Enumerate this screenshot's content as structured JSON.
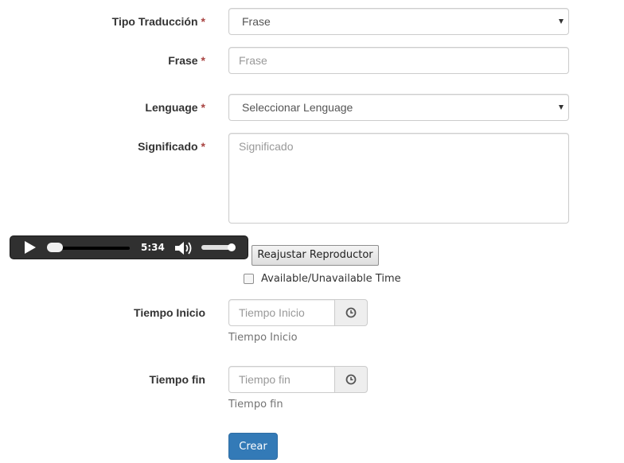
{
  "form": {
    "tipo_traduccion": {
      "label": "Tipo Traducción",
      "required_mark": "*",
      "selected": "Frase"
    },
    "frase": {
      "label": "Frase",
      "required_mark": "*",
      "placeholder": "Frase"
    },
    "lenguage": {
      "label": "Lenguage",
      "required_mark": "*",
      "selected": "Seleccionar Lenguage"
    },
    "significado": {
      "label": "Significado",
      "required_mark": "*",
      "placeholder": "Significado"
    },
    "player": {
      "time": "5:34",
      "progress": 0.08,
      "volume": 0.85
    },
    "reset_button": "Reajustar Reproductor",
    "availability_checkbox": {
      "label": "Available/Unavailable Time",
      "checked": false
    },
    "tiempo_inicio": {
      "label": "Tiempo Inicio",
      "placeholder": "Tiempo Inicio",
      "help": "Tiempo Inicio"
    },
    "tiempo_fin": {
      "label": "Tiempo fin",
      "placeholder": "Tiempo fin",
      "help": "Tiempo fin"
    },
    "submit": "Crear"
  },
  "icons": {
    "clock": "clock-icon",
    "play": "play-icon",
    "volume": "volume-icon"
  },
  "colors": {
    "primary": "#337ab7",
    "required": "#a94442",
    "help_text": "#737373"
  }
}
